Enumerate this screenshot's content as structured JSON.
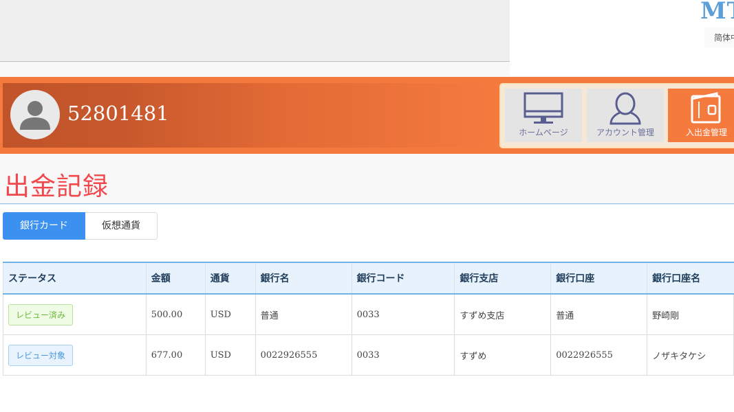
{
  "brand": {
    "logo_text": "MT",
    "language": "简体中文"
  },
  "user": {
    "account_id": "52801481"
  },
  "nav": [
    {
      "label": "ホームページ",
      "icon": "monitor-icon",
      "active": false
    },
    {
      "label": "アカウント管理",
      "icon": "user-icon",
      "active": false
    },
    {
      "label": "入出金管理",
      "icon": "wallet-icon",
      "active": true
    }
  ],
  "page": {
    "title": "出金記録"
  },
  "tabs": [
    {
      "label": "銀行カード",
      "active": true
    },
    {
      "label": "仮想通貨",
      "active": false
    }
  ],
  "table": {
    "columns": [
      "ステータス",
      "金額",
      "通貨",
      "銀行名",
      "銀行コード",
      "銀行支店",
      "銀行口座",
      "銀行口座名"
    ],
    "rows": [
      {
        "status": "レビュー済み",
        "status_color": "green",
        "amount": "500.00",
        "currency": "USD",
        "bank_name": "普通",
        "bank_code": "0033",
        "branch": "すずめ支店",
        "account": "普通",
        "account_name": "野崎剛"
      },
      {
        "status": "レビュー対象",
        "status_color": "blue",
        "amount": "677.00",
        "currency": "USD",
        "bank_name": "0022926555",
        "bank_code": "0033",
        "branch": "すずめ",
        "account": "0022926555",
        "account_name": "ノザキタケシ"
      }
    ]
  },
  "colors": {
    "accent_orange": "#f47a3e",
    "title_red": "#f0484c",
    "tab_blue": "#3c91f0"
  }
}
